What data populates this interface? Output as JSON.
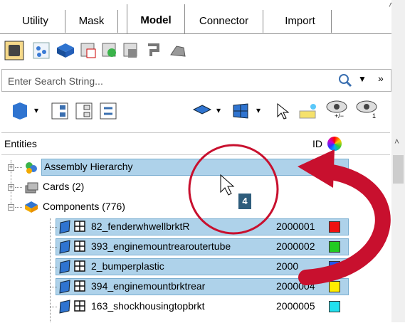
{
  "tabs": [
    "Utility",
    "Mask",
    "Model",
    "Connector",
    "Import"
  ],
  "active_tab": "Model",
  "search": {
    "placeholder": "Enter Search String..."
  },
  "tree": {
    "header_entities": "Entities",
    "header_id": "ID",
    "rows": [
      {
        "label": "Assembly Hierarchy",
        "id": "",
        "color": ""
      },
      {
        "label": "Cards (2)",
        "id": "",
        "color": ""
      },
      {
        "label": "Components (776)",
        "id": "",
        "color": ""
      },
      {
        "label": "82_fenderwhwellbrktR",
        "id": "2000001",
        "color": "#ee1111"
      },
      {
        "label": "393_enginemountrearoutertube",
        "id": "2000002",
        "color": "#22cc22"
      },
      {
        "label": "2_bumperplastic",
        "id": "2000",
        "color": "#2255ee"
      },
      {
        "label": "394_enginemountbrktrear",
        "id": "2000004",
        "color": "#ffee00"
      },
      {
        "label": "163_shockhousingtopbrkt",
        "id": "2000005",
        "color": "#22e0ee"
      }
    ]
  },
  "annotation": {
    "badge": "4"
  },
  "colors": {
    "selection": "#aed2ea",
    "arrow": "#c8102e"
  }
}
